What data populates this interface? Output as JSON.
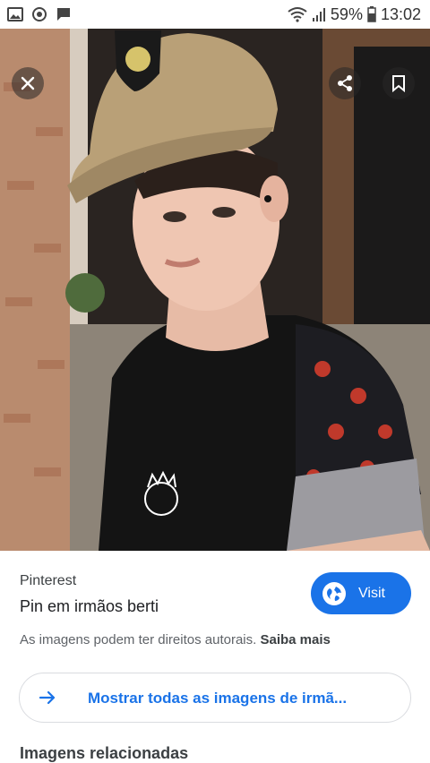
{
  "status_bar": {
    "icons_left": [
      "image-icon",
      "sync-icon",
      "message-icon"
    ],
    "battery": "59%",
    "time": "13:02"
  },
  "photo": {
    "description_icons": [
      "close-icon",
      "share-icon",
      "bookmark-icon"
    ]
  },
  "result": {
    "source": "Pinterest",
    "title": "Pin em irmãos berti",
    "visit_label": "Visit",
    "copyright_text": "As imagens podem ter direitos autorais.",
    "copyright_link": "Saiba mais",
    "show_all_label": "Mostrar todas as imagens de irmã..."
  },
  "related": {
    "heading": "Imagens relacionadas"
  },
  "colors": {
    "accent": "#1a73e8"
  }
}
